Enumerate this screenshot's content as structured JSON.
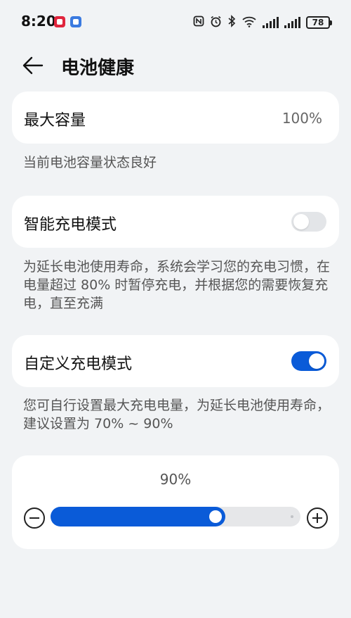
{
  "status_bar": {
    "time": "8:20",
    "battery": "78",
    "icons": [
      "nfc-icon",
      "alarm-icon",
      "bluetooth-icon",
      "wifi-icon",
      "signal-icon",
      "signal-icon",
      "battery-icon"
    ]
  },
  "header": {
    "title": "电池健康",
    "back_icon": "arrow-left-icon"
  },
  "max_capacity": {
    "label": "最大容量",
    "value": "100%",
    "description": "当前电池容量状态良好"
  },
  "smart_charging": {
    "label": "智能充电模式",
    "enabled": false,
    "description": "为延长电池使用寿命，系统会学习您的充电习惯，在电量超过 80% 时暂停充电，并根据您的需要恢复充电，直至充满"
  },
  "custom_charging": {
    "label": "自定义充电模式",
    "enabled": true,
    "description": "您可自行设置最大充电电量，为延长电池使用寿命，建议设置为 70% ~ 90%"
  },
  "charge_limit": {
    "value_label": "90%",
    "value": 0.7,
    "minus_icon": "minus-circle-icon",
    "plus_icon": "plus-circle-icon"
  },
  "colors": {
    "accent": "#0a5bd8",
    "background": "#f1f3f5",
    "card": "#ffffff"
  }
}
